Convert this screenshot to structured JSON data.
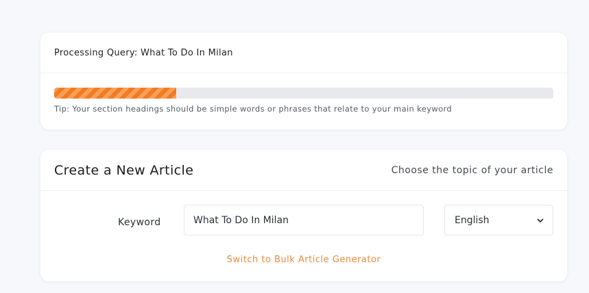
{
  "progress_card": {
    "title": "Processing Query: What To Do In Milan",
    "progress_fraction": 0.245,
    "tip": "Tip: Your section headings should be simple words or phrases that relate to your main keyword"
  },
  "article_card": {
    "title": "Create a New Article",
    "subtitle": "Choose the topic of your article",
    "keyword_label": "Keyword",
    "keyword_value": "What To Do In Milan",
    "language_value": "English",
    "bulk_link": "Switch to Bulk Article Generator"
  },
  "colors": {
    "accent": "#f47b1e",
    "link": "#e98a3a",
    "background": "#f6f8fc"
  },
  "icons": {
    "language_dropdown": "chevron-down-icon"
  }
}
